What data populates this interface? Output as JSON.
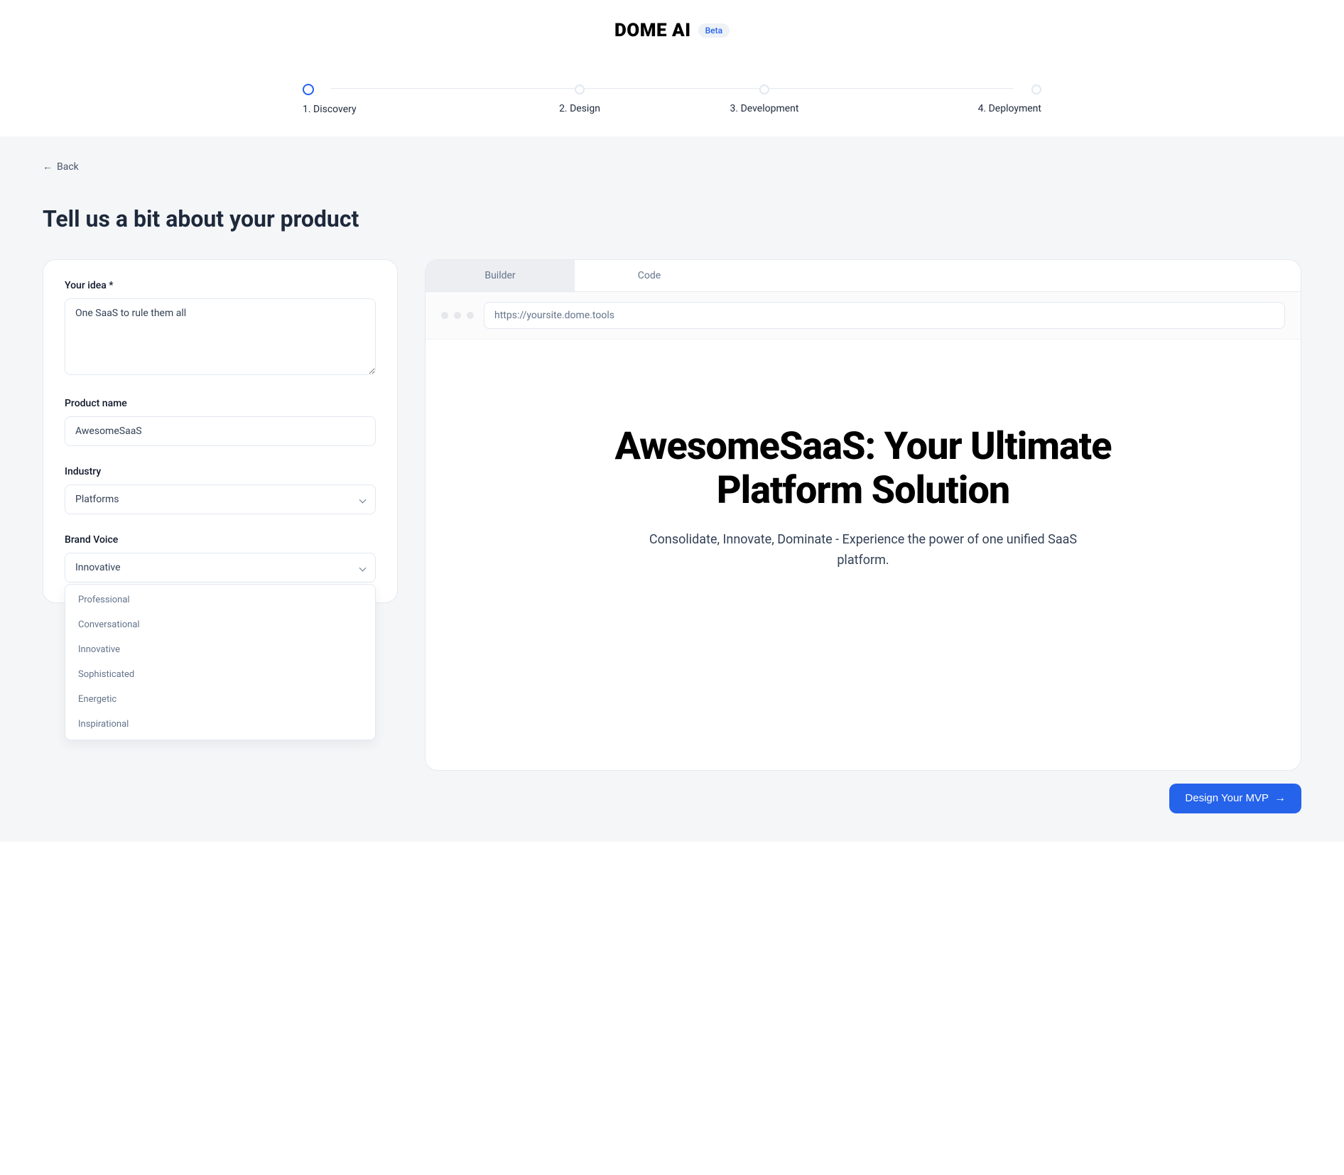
{
  "header": {
    "logo": "DOME AI",
    "badge": "Beta"
  },
  "stepper": {
    "steps": [
      {
        "label": "1. Discovery",
        "active": true
      },
      {
        "label": "2. Design",
        "active": false
      },
      {
        "label": "3. Development",
        "active": false
      },
      {
        "label": "4. Deployment",
        "active": false
      }
    ]
  },
  "back": {
    "label": "Back"
  },
  "page": {
    "title": "Tell us a bit about your product"
  },
  "form": {
    "idea_label": "Your idea *",
    "idea_value": "One SaaS to rule them all",
    "product_name_label": "Product name",
    "product_name_value": "AwesomeSaaS",
    "industry_label": "Industry",
    "industry_value": "Platforms",
    "brand_voice_label": "Brand Voice",
    "brand_voice_value": "Innovative",
    "brand_voice_options": [
      "Professional",
      "Conversational",
      "Innovative",
      "Sophisticated",
      "Energetic",
      "Inspirational"
    ]
  },
  "preview": {
    "tabs": {
      "builder": "Builder",
      "code": "Code"
    },
    "url": "https://yoursite.dome.tools",
    "heading": "AwesomeSaaS: Your Ultimate Platform Solution",
    "subheading": "Consolidate, Innovate, Dominate - Experience the power of one unified SaaS platform."
  },
  "cta": {
    "label": "Design Your MVP"
  }
}
